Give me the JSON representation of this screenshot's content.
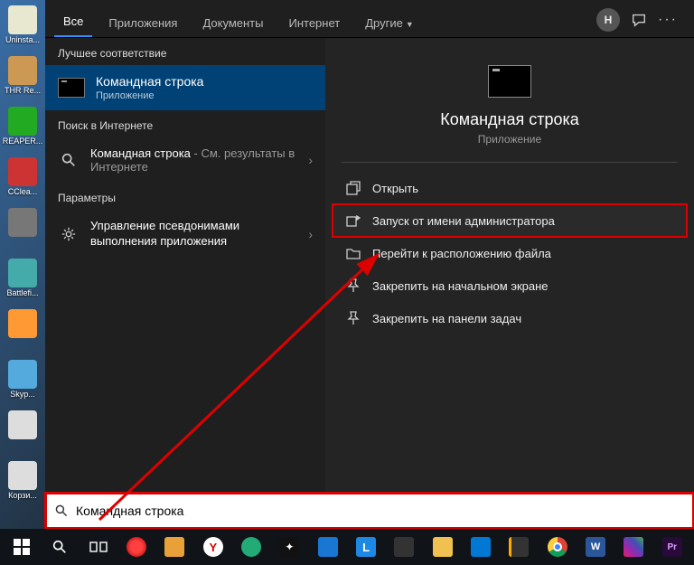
{
  "desktop_icons": [
    "Uninsta...",
    "THR Re...",
    "REAPER...",
    "CClea...",
    "",
    "Battlefi...",
    "",
    "Skyp...",
    "",
    "Корзи..."
  ],
  "tabs": {
    "all": "Все",
    "apps": "Приложения",
    "docs": "Документы",
    "internet": "Интернет",
    "other": "Другие"
  },
  "header": {
    "avatar_initial": "Н"
  },
  "sections": {
    "best_match": "Лучшее соответствие",
    "web": "Поиск в Интернете",
    "settings": "Параметры"
  },
  "results": {
    "cmd": {
      "title": "Командная строка",
      "subtitle": "Приложение"
    },
    "web": {
      "title": "Командная строка",
      "suffix": " - См. результаты в Интернете"
    },
    "alias": {
      "title": "Управление псевдонимами выполнения приложения"
    }
  },
  "preview": {
    "title": "Командная строка",
    "subtitle": "Приложение"
  },
  "actions": {
    "open": "Открыть",
    "run_admin": "Запуск от имени администратора",
    "file_location": "Перейти к расположению файла",
    "pin_start": "Закрепить на начальном экране",
    "pin_taskbar": "Закрепить на панели задач"
  },
  "search": {
    "value": "Командная строка"
  }
}
